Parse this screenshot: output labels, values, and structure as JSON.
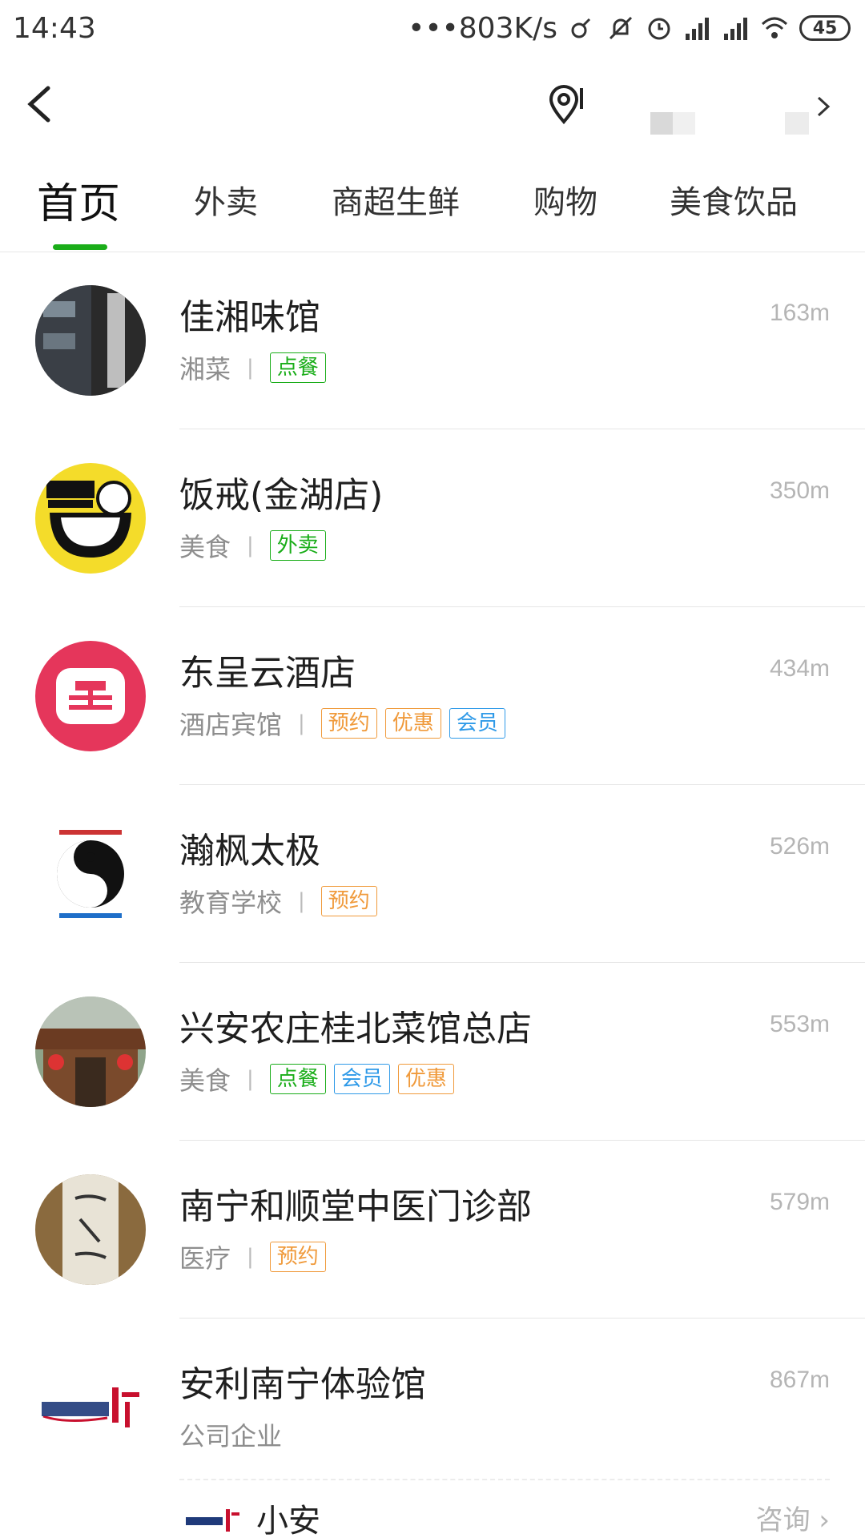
{
  "status_bar": {
    "time": "14:43",
    "network_speed": "•••803K/s",
    "battery": "45"
  },
  "tabs": [
    {
      "label": "首页",
      "active": true
    },
    {
      "label": "外卖"
    },
    {
      "label": "商超生鲜"
    },
    {
      "label": "购物"
    },
    {
      "label": "美食饮品"
    }
  ],
  "accent_color": "#1aad19",
  "tag_colors": {
    "green": "#1aad19",
    "orange": "#f09a3b",
    "blue": "#2f9ae8"
  },
  "items": [
    {
      "name": "佳湘味馆",
      "category": "湘菜",
      "distance": "163m",
      "tags": [
        "点餐"
      ]
    },
    {
      "name": "饭戒(金湖店)",
      "category": "美食",
      "distance": "350m",
      "tags": [
        "外卖"
      ]
    },
    {
      "name": "东呈云酒店",
      "category": "酒店宾馆",
      "distance": "434m",
      "tags": [
        "预约",
        "优惠",
        "会员"
      ]
    },
    {
      "name": "瀚枫太极",
      "category": "教育学校",
      "distance": "526m",
      "tags": [
        "预约"
      ]
    },
    {
      "name": "兴安农庄桂北菜馆总店",
      "category": "美食",
      "distance": "553m",
      "tags": [
        "点餐",
        "会员",
        "优惠"
      ]
    },
    {
      "name": "南宁和顺堂中医门诊部",
      "category": "医疗",
      "distance": "579m",
      "tags": [
        "预约"
      ]
    },
    {
      "name": "安利南宁体验馆",
      "category": "公司企业",
      "distance": "867m",
      "tags": []
    }
  ],
  "sub_item": {
    "name": "小安",
    "link": "咨询"
  }
}
